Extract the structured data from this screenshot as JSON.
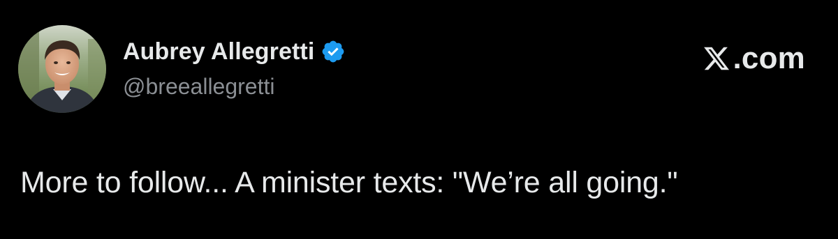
{
  "author": {
    "display_name": "Aubrey Allegretti",
    "handle": "@breeallegretti",
    "verified": true,
    "avatar": "avatar-photo"
  },
  "brand": {
    "label": ".com",
    "icon": "x-logo-icon"
  },
  "tweet": {
    "text": "More to follow... A minister texts: \"We’re all going.\""
  },
  "colors": {
    "background": "#000000",
    "primary_text": "#e7e9ea",
    "secondary_text": "#8b8f94",
    "verified_badge": "#1d9bf0"
  }
}
